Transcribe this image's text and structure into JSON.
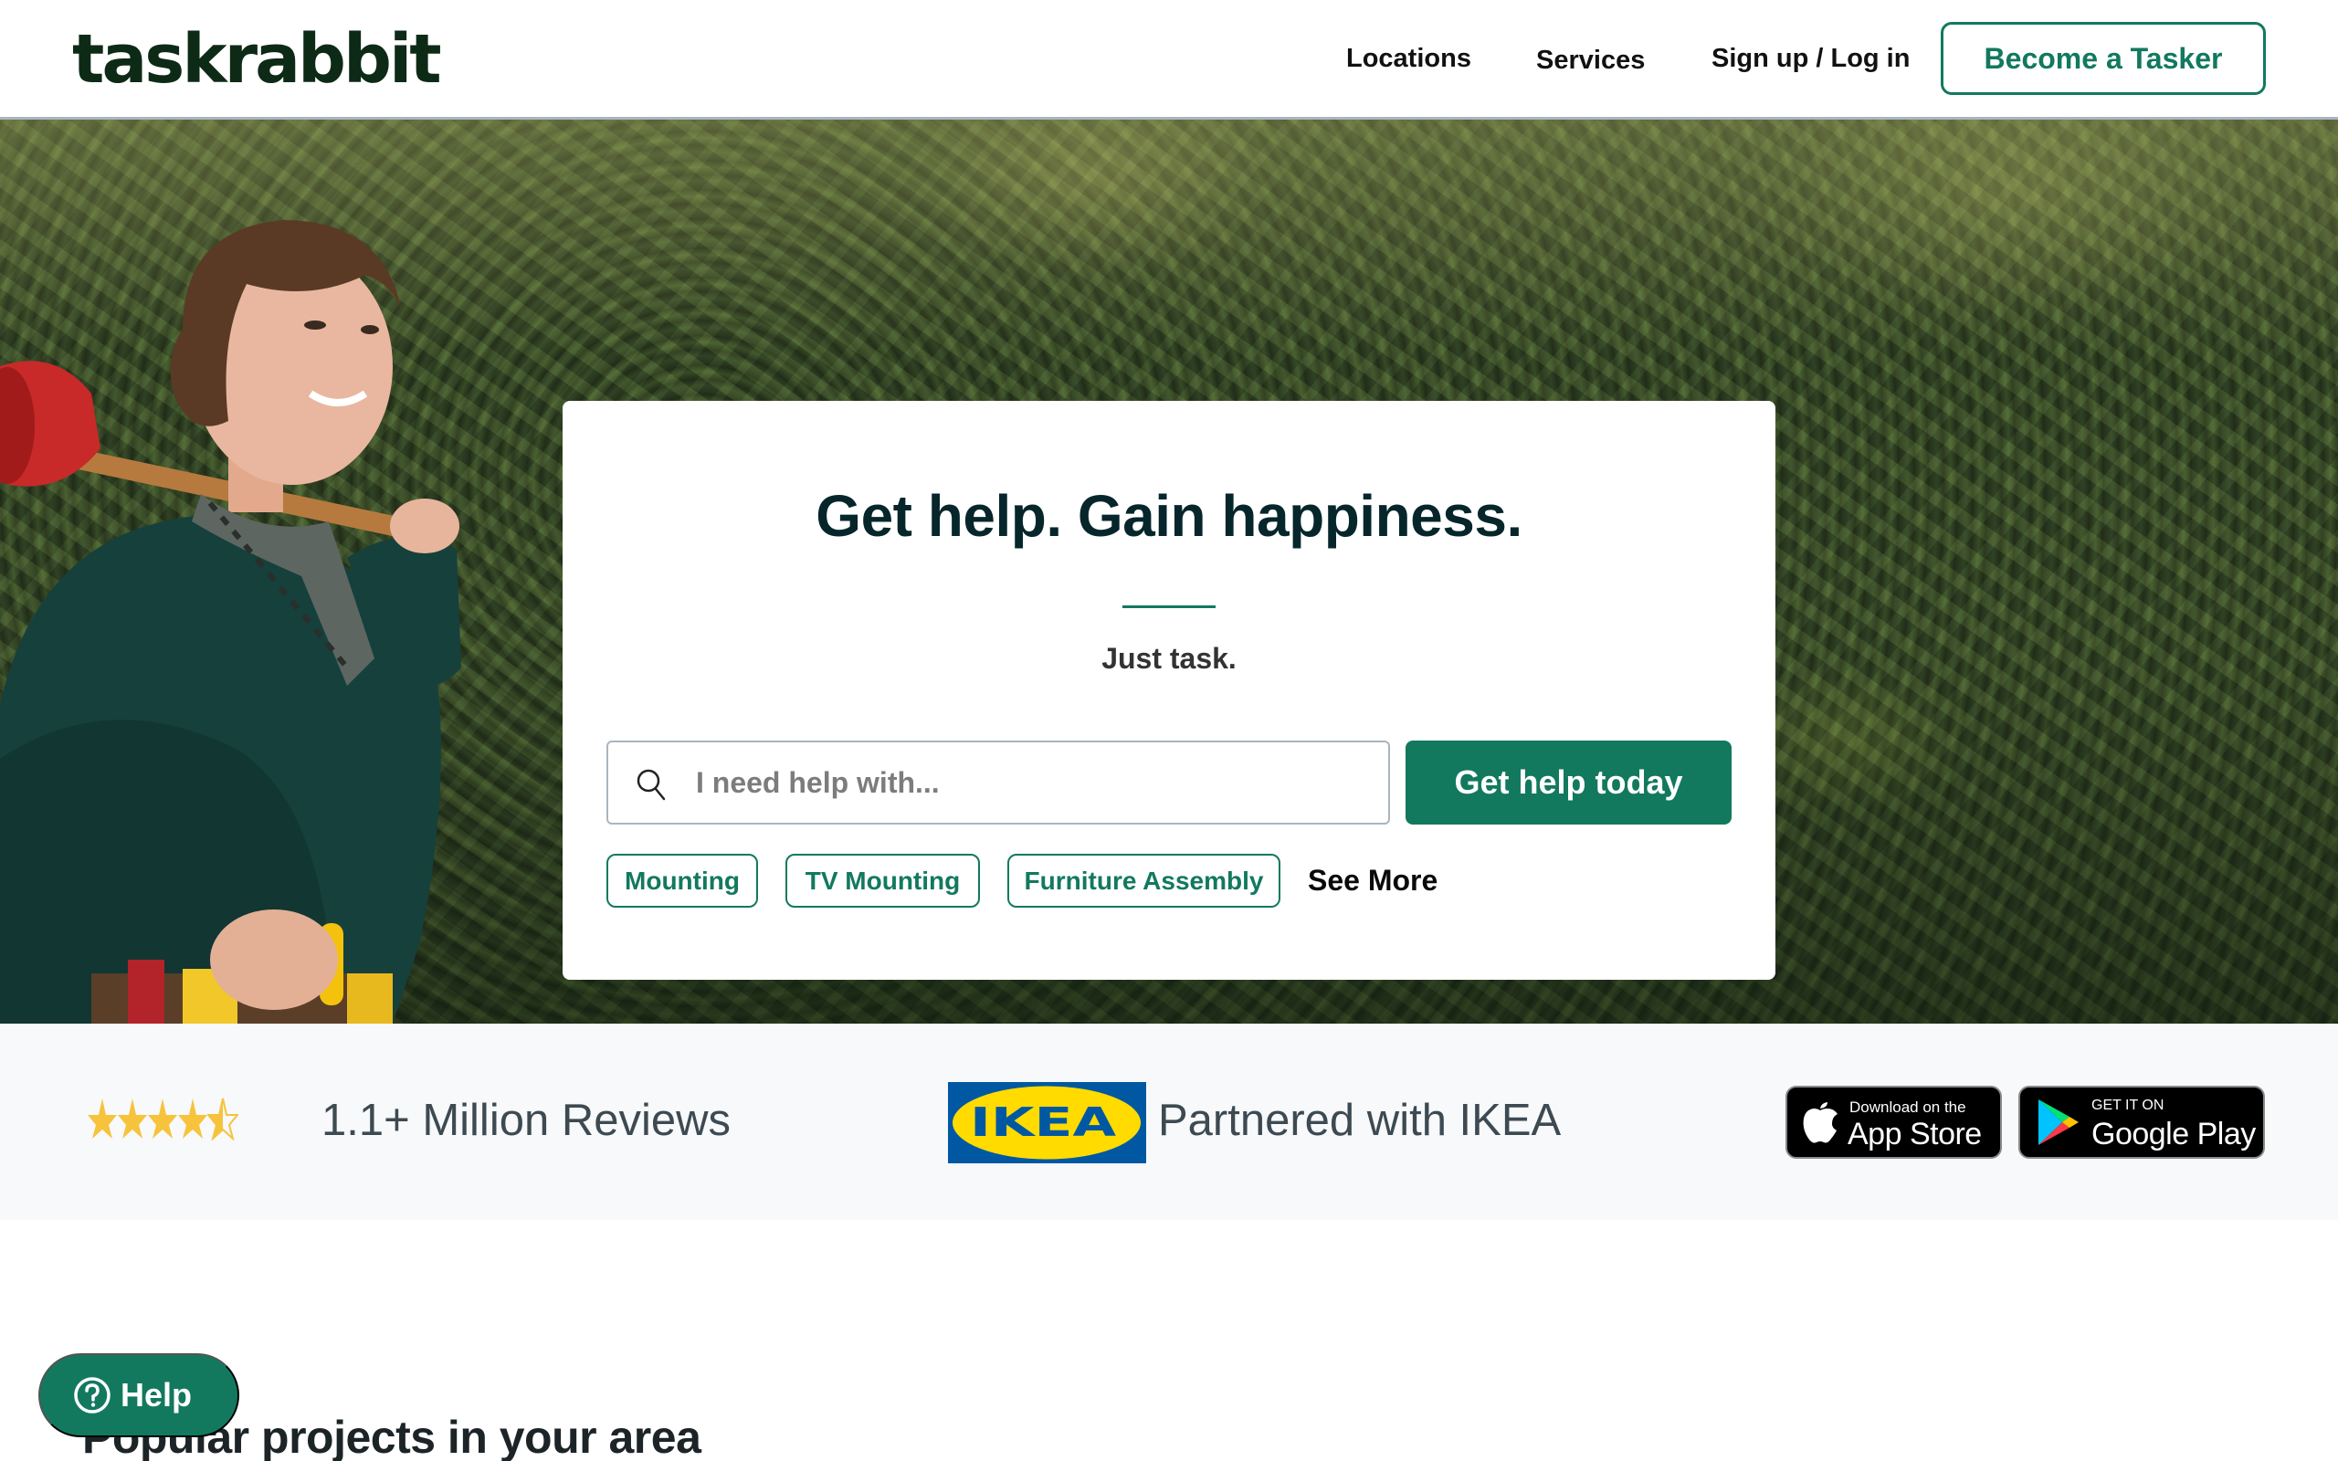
{
  "header": {
    "logo": "taskrabbit",
    "nav": [
      {
        "label": "Locations"
      },
      {
        "label": "Services"
      },
      {
        "label": "Sign up / Log in"
      }
    ],
    "become_tasker": "Become a Tasker"
  },
  "hero": {
    "title": "Get help. Gain happiness.",
    "subtitle": "Just task.",
    "search": {
      "placeholder": "I need help with...",
      "value": "",
      "icon": "search-icon"
    },
    "cta_label": "Get help today",
    "chips": [
      {
        "label": "Mounting"
      },
      {
        "label": "TV Mounting"
      },
      {
        "label": "Furniture Assembly"
      }
    ],
    "see_more": "See More"
  },
  "trust": {
    "rating": {
      "value": 4.5,
      "max": 5
    },
    "reviews": "1.1+ Million Reviews",
    "ikea_logo_text": "IKEA",
    "partner_text": "Partnered with IKEA",
    "app_store": {
      "small": "Download on the",
      "big": "App Store"
    },
    "google_play": {
      "small": "GET IT ON",
      "big": "Google Play"
    }
  },
  "section": {
    "title": "Popular projects in your area"
  },
  "help_button": {
    "label": "Help",
    "icon": "question-circle-icon"
  },
  "colors": {
    "brand_green": "#12795f",
    "logo_dark": "#0d2a16",
    "title_dark": "#06262b",
    "star_yellow": "#f7c33c",
    "band_bg": "#f7f9fb",
    "ikea_blue": "#0058a3",
    "ikea_yellow": "#ffdb00"
  }
}
